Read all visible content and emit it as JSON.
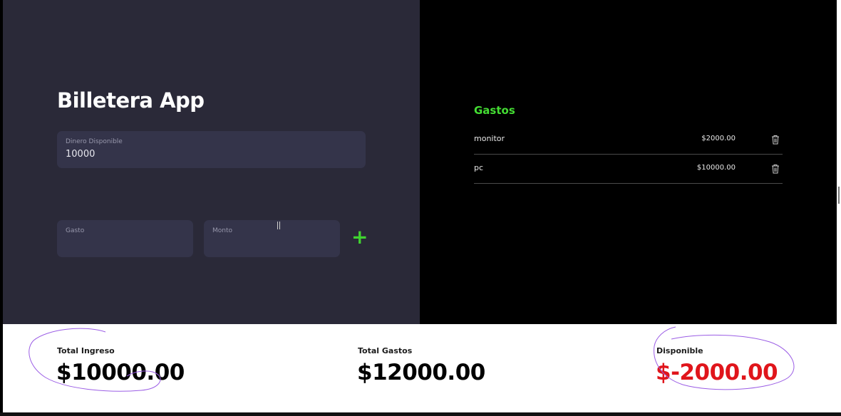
{
  "app": {
    "title": "Billetera App"
  },
  "form": {
    "dinero_label": "Dinero Disponible",
    "dinero_value": "10000",
    "gasto_label": "Gasto",
    "gasto_value": "",
    "monto_label": "Monto",
    "monto_value": "",
    "add_symbol": "+"
  },
  "gastos": {
    "title": "Gastos",
    "items": [
      {
        "name": "monitor",
        "amount": "$2000.00"
      },
      {
        "name": "pc",
        "amount": "$10000.00"
      }
    ]
  },
  "summary": {
    "ingreso_label": "Total Ingreso",
    "ingreso_value": "$10000.00",
    "gastos_label": "Total Gastos",
    "gastos_value": "$12000.00",
    "disponible_label": "Disponible",
    "disponible_value": "$-2000.00"
  },
  "colors": {
    "accent_green": "#44dd33",
    "negative_red": "#e0151b",
    "annotation": "#9b5de5"
  },
  "icons": {
    "trash": "trash-icon",
    "add": "plus-icon"
  }
}
